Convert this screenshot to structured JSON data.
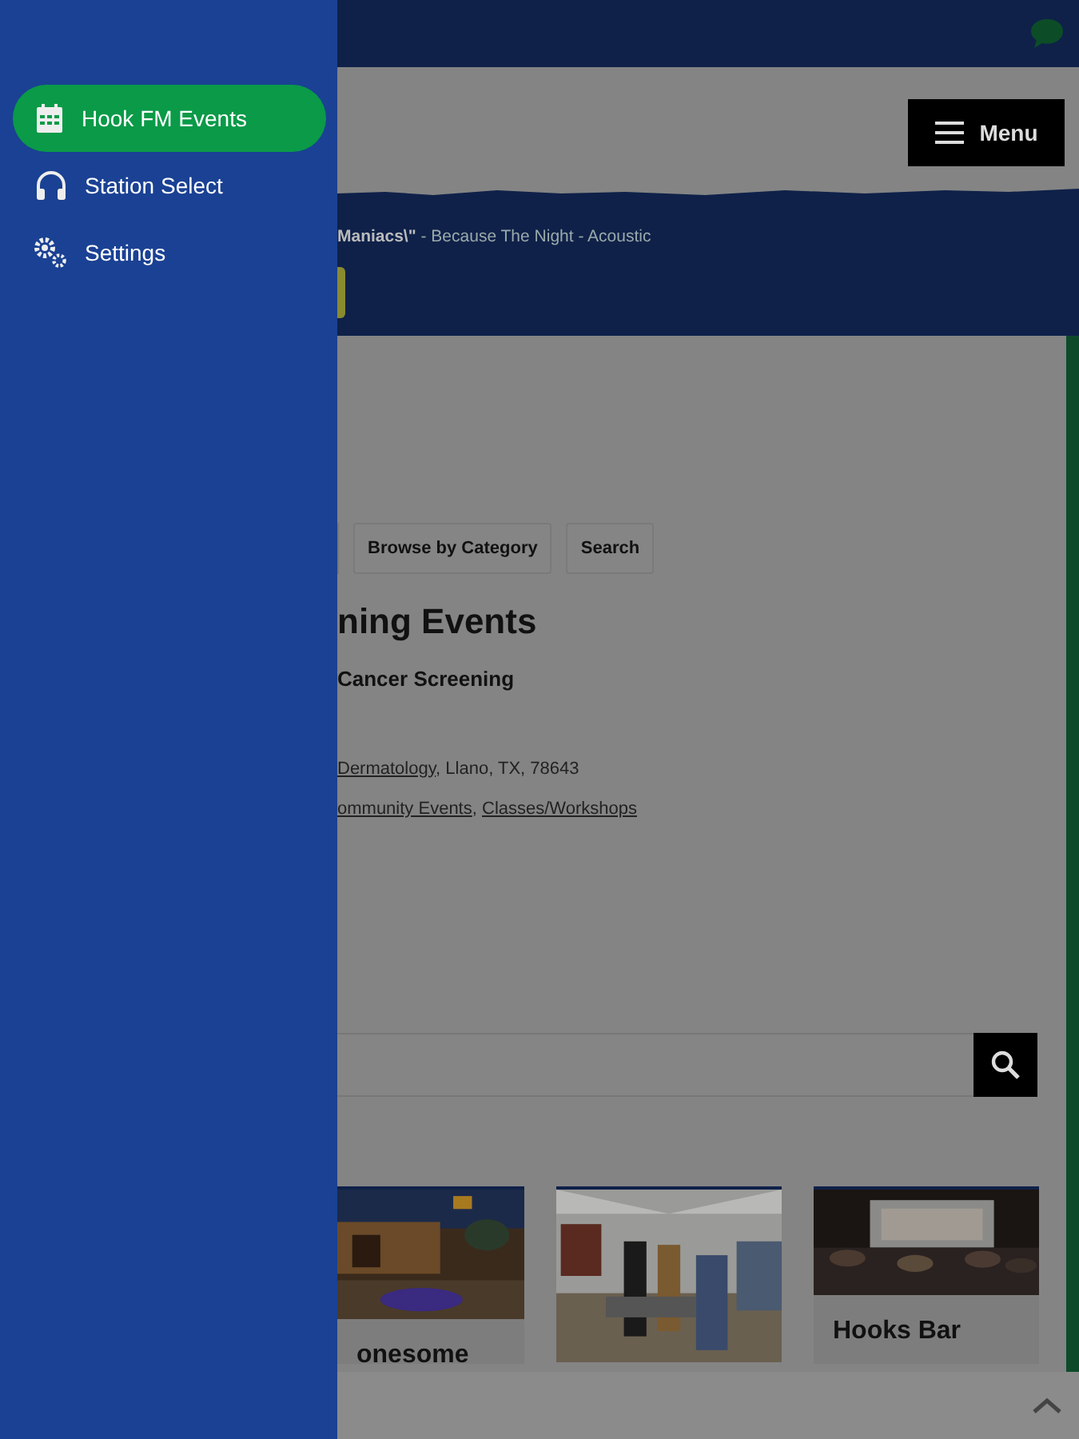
{
  "drawer": {
    "items": [
      {
        "label": "Hook FM Events",
        "selected": true
      },
      {
        "label": "Station Select",
        "selected": false
      },
      {
        "label": "Settings",
        "selected": false
      }
    ]
  },
  "header": {
    "menu_button": "Menu"
  },
  "now_playing": "**Maniacs\\\"** - Because The Night - Acoustic",
  "filter_buttons": [
    "Browse by Category",
    "Search"
  ],
  "heading": "ning Events",
  "event": {
    "title": "Cancer Screening",
    "location_link": "Dermatology",
    "location_rest": ", Llano, TX, 78643",
    "categories": [
      "ommunity Events",
      "Classes/Workshops"
    ],
    "category_separator": ", "
  },
  "cards": [
    {
      "kind": "picture",
      "title": "onesome"
    },
    {
      "kind": "picture"
    },
    {
      "kind": "picture",
      "title": "Hooks Bar"
    }
  ]
}
